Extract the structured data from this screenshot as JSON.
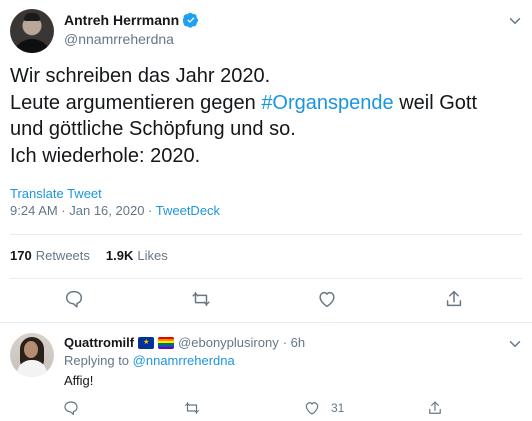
{
  "tweet": {
    "author_name": "Antreh Herrmann",
    "author_handle": "@nnamrreherdna",
    "text_line1": "Wir schreiben das Jahr 2020.",
    "text_line2_prefix": "Leute argumentieren gegen ",
    "hashtag": "#Organspende",
    "text_line2_suffix": " weil Gott",
    "text_line3": "und göttliche Schöpfung und so.",
    "text_line4": "Ich wiederhole: 2020.",
    "translate_label": "Translate Tweet",
    "timestamp": "9:24 AM · Jan 16, 2020 · ",
    "source": "TweetDeck",
    "retweets_count": "170",
    "retweets_label": "Retweets",
    "likes_count": "1.9K",
    "likes_label": "Likes"
  },
  "reply": {
    "author_name": "Quattromilf",
    "author_handle": "@ebonyplusirony",
    "time_ago": "· 6h",
    "replying_prefix": "Replying to ",
    "replying_to": "@nnamrreherdna",
    "text": "Affig!",
    "likes_count": "31"
  },
  "colors": {
    "accent": "#1b95e0",
    "muted": "#657786",
    "text": "#14171a",
    "divider": "#e6ecf0"
  },
  "icons": {
    "verified": "verified-badge-icon",
    "reply": "reply-icon",
    "retweet": "retweet-icon",
    "like": "heart-icon",
    "share": "share-icon",
    "more": "chevron-down-icon"
  }
}
